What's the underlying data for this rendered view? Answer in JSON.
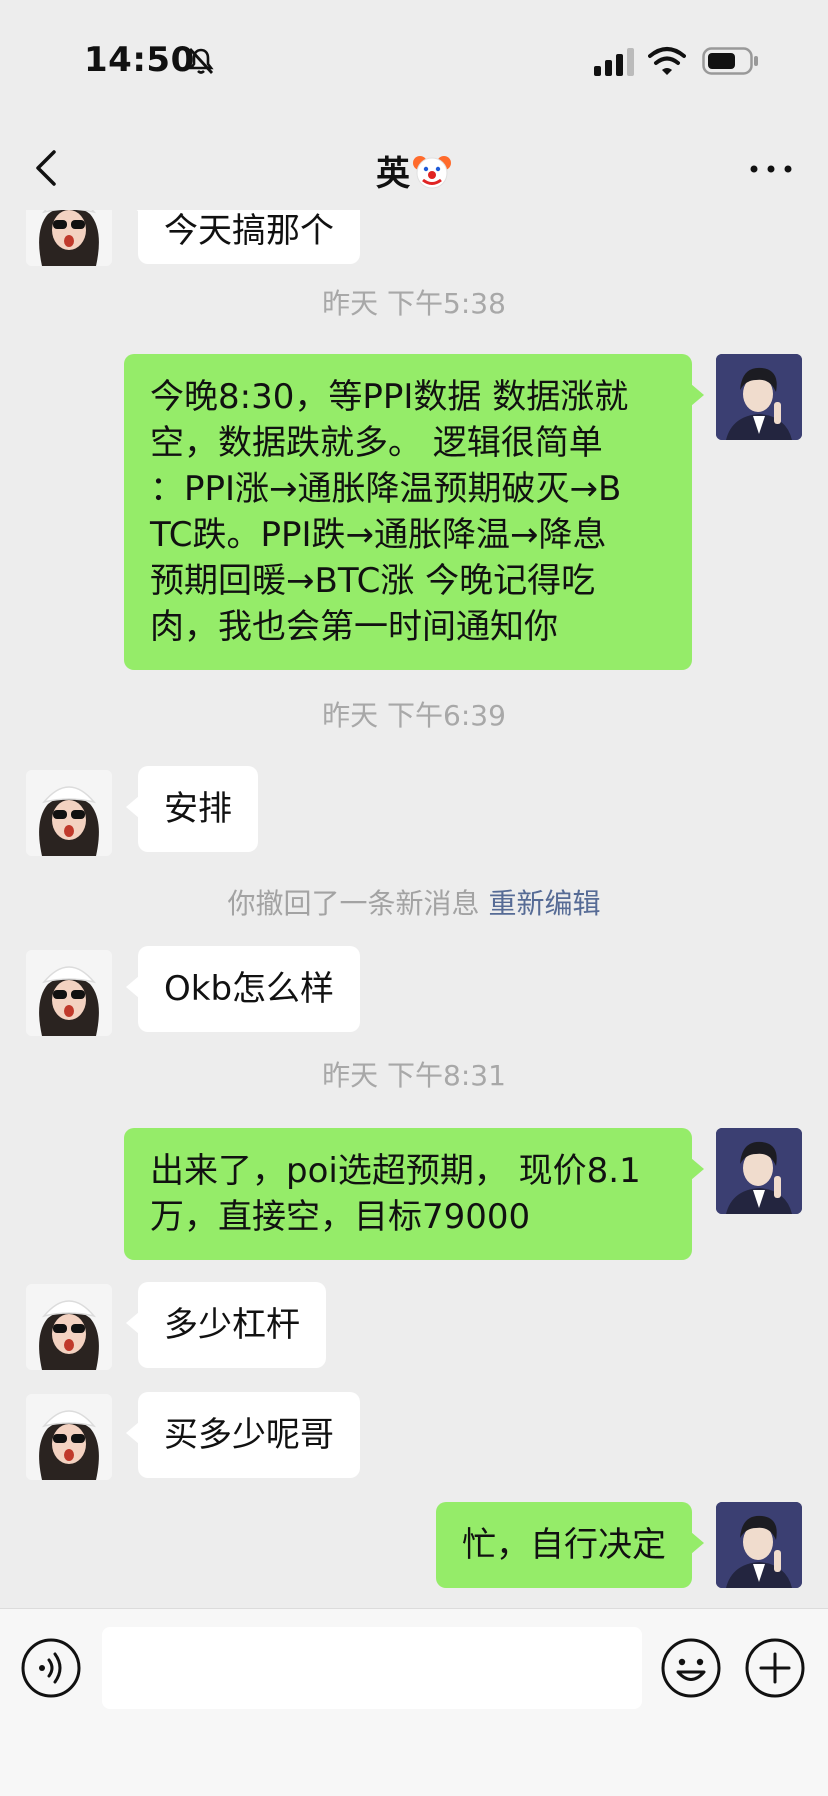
{
  "status_bar": {
    "time": "14:50"
  },
  "nav": {
    "title": "英"
  },
  "messages": {
    "partial_top": "今天搞那个",
    "ts1": "昨天 下午5:38",
    "out1_lines": [
      "今晚8:30，等PPI数据 数据涨就",
      "空，数据跌就多。 逻辑很简单",
      "：PPI涨→通胀降温预期破灭→B",
      "TC跌。PPI跌→通胀降温→降息",
      "预期回暖→BTC涨 今晚记得吃",
      "肉，我也会第一时间通知你"
    ],
    "ts2": "昨天 下午6:39",
    "in1": "安排",
    "recall_text": "你撤回了一条新消息",
    "recall_link": "重新编辑",
    "in2": "Okb怎么样",
    "ts3": "昨天 下午8:31",
    "out2_lines": [
      "出来了，poi选超预期， 现价8.1",
      "万，直接空，目标79000"
    ],
    "in3": "多少杠杆",
    "in4": "买多少呢哥",
    "out3": "忙，自行决定"
  },
  "input": {
    "value": ""
  },
  "colors": {
    "background": "#ededed",
    "outgoing_bubble": "#95ec69",
    "incoming_bubble": "#ffffff",
    "link": "#566b95",
    "timestamp": "#a8a8a8"
  },
  "icons": [
    "mute-icon",
    "signal-icon",
    "wifi-icon",
    "battery-icon",
    "back-arrow-icon",
    "clown-emoji-icon",
    "more-icon",
    "voice-icon",
    "emoji-icon",
    "plus-icon"
  ]
}
